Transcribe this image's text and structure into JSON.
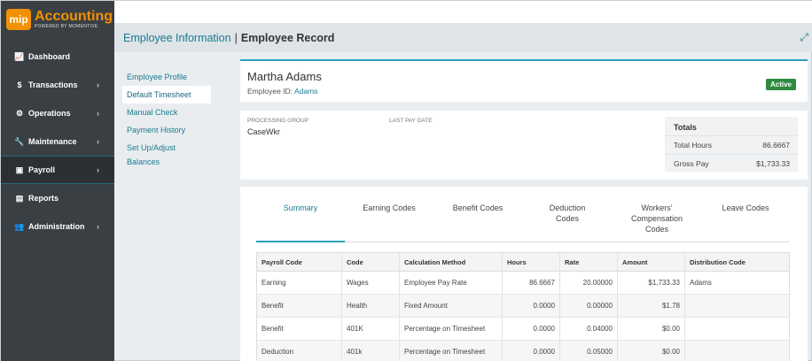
{
  "logo": {
    "badge": "mip",
    "title": "Accounting",
    "subtitle": "POWERED BY MOMENTIVE"
  },
  "sidebar": {
    "items": [
      {
        "label": "Dashboard",
        "icon": "📈",
        "chevron": ""
      },
      {
        "label": "Transactions",
        "icon": "$",
        "chevron": "›"
      },
      {
        "label": "Operations",
        "icon": "⚙",
        "chevron": "›"
      },
      {
        "label": "Maintenance",
        "icon": "🔧",
        "chevron": "›"
      },
      {
        "label": "Payroll",
        "icon": "▣",
        "chevron": "›"
      },
      {
        "label": "Reports",
        "icon": "▤",
        "chevron": ""
      },
      {
        "label": "Administration",
        "icon": "👥",
        "chevron": "›"
      }
    ]
  },
  "titlebar": {
    "part1": "Employee Information",
    "sep": "|",
    "part2": "Employee Record",
    "expand": "⤢"
  },
  "subnav": {
    "items": [
      "Employee Profile",
      "Default Timesheet",
      "Manual Check",
      "Payment History",
      "Set Up/Adjust Balances"
    ]
  },
  "employee": {
    "name": "Martha Adams",
    "id_label": "Employee ID:",
    "id_value": "Adams",
    "status": "Active"
  },
  "group": {
    "processing_label": "PROCESSING GROUP",
    "processing_value": "CaseWkr",
    "lastpay_label": "LAST PAY DATE"
  },
  "totals": {
    "title": "Totals",
    "hours_label": "Total Hours",
    "hours_value": "86.6667",
    "gross_label": "Gross Pay",
    "gross_value": "$1,733.33"
  },
  "tabs": [
    "Summary",
    "Earning Codes",
    "Benefit Codes",
    "Deduction Codes",
    "Workers' Compensation Codes",
    "Leave Codes"
  ],
  "table": {
    "headers": [
      "Payroll Code",
      "Code",
      "Calculation Method",
      "Hours",
      "Rate",
      "Amount",
      "Distribution Code"
    ],
    "rows": [
      [
        "Earning",
        "Wages",
        "Employee Pay Rate",
        "86.6667",
        "20.00000",
        "$1,733.33",
        "Adams"
      ],
      [
        "Benefit",
        "Health",
        "Fixed Amount",
        "0.0000",
        "0.00000",
        "$1.78",
        ""
      ],
      [
        "Benefit",
        "401K",
        "Percentage on Timesheet",
        "0.0000",
        "0.04000",
        "$0.00",
        ""
      ],
      [
        "Deduction",
        "401k",
        "Percentage on Timesheet",
        "0.0000",
        "0.05000",
        "$0.00",
        ""
      ]
    ]
  }
}
